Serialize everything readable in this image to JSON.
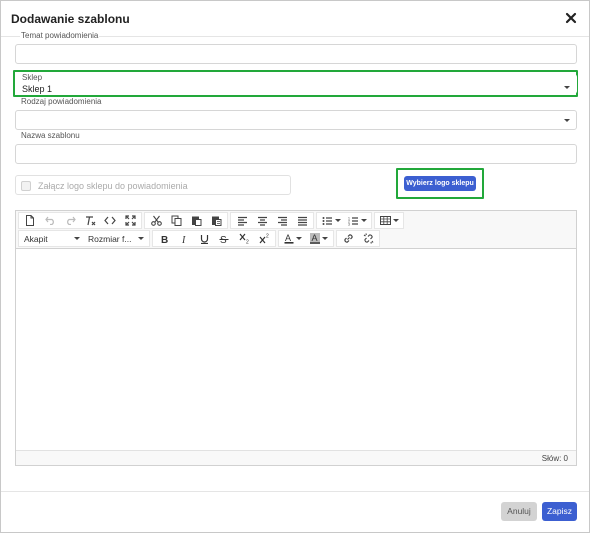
{
  "modal": {
    "title": "Dodawanie szablonu"
  },
  "form": {
    "subject_label": "Temat powiadomienia",
    "subject_value": "",
    "shop_label": "Sklep",
    "shop_value": "Sklep 1",
    "type_label": "Rodzaj powiadomienia",
    "type_value": "",
    "name_label": "Nazwa szablonu",
    "name_value": "",
    "attach_logo_label": "Załącz logo sklepu do powiadomienia",
    "choose_logo_button": "Wybierz logo sklepu"
  },
  "editor": {
    "paragraph_select": "Akapit",
    "font_size_select": "Rozmiar f...",
    "word_count": "Słów: 0",
    "toolbar_icons": [
      "new-document-icon",
      "undo-icon",
      "redo-icon",
      "clear-format-icon",
      "source-code-icon",
      "fullscreen-icon",
      "cut-icon",
      "copy-icon",
      "paste-icon",
      "paste-text-icon",
      "align-left-icon",
      "align-center-icon",
      "align-right-icon",
      "align-justify-icon",
      "bullet-list-icon",
      "numbered-list-icon",
      "table-icon",
      "bold-icon",
      "italic-icon",
      "underline-icon",
      "strikethrough-icon",
      "subscript-icon",
      "superscript-icon",
      "text-color-icon",
      "background-color-icon",
      "link-icon",
      "unlink-icon"
    ]
  },
  "footer": {
    "cancel_label": "Anuluj",
    "save_label": "Zapisz"
  },
  "colors": {
    "primary": "#3c5fd1",
    "highlight": "#22a83a"
  }
}
